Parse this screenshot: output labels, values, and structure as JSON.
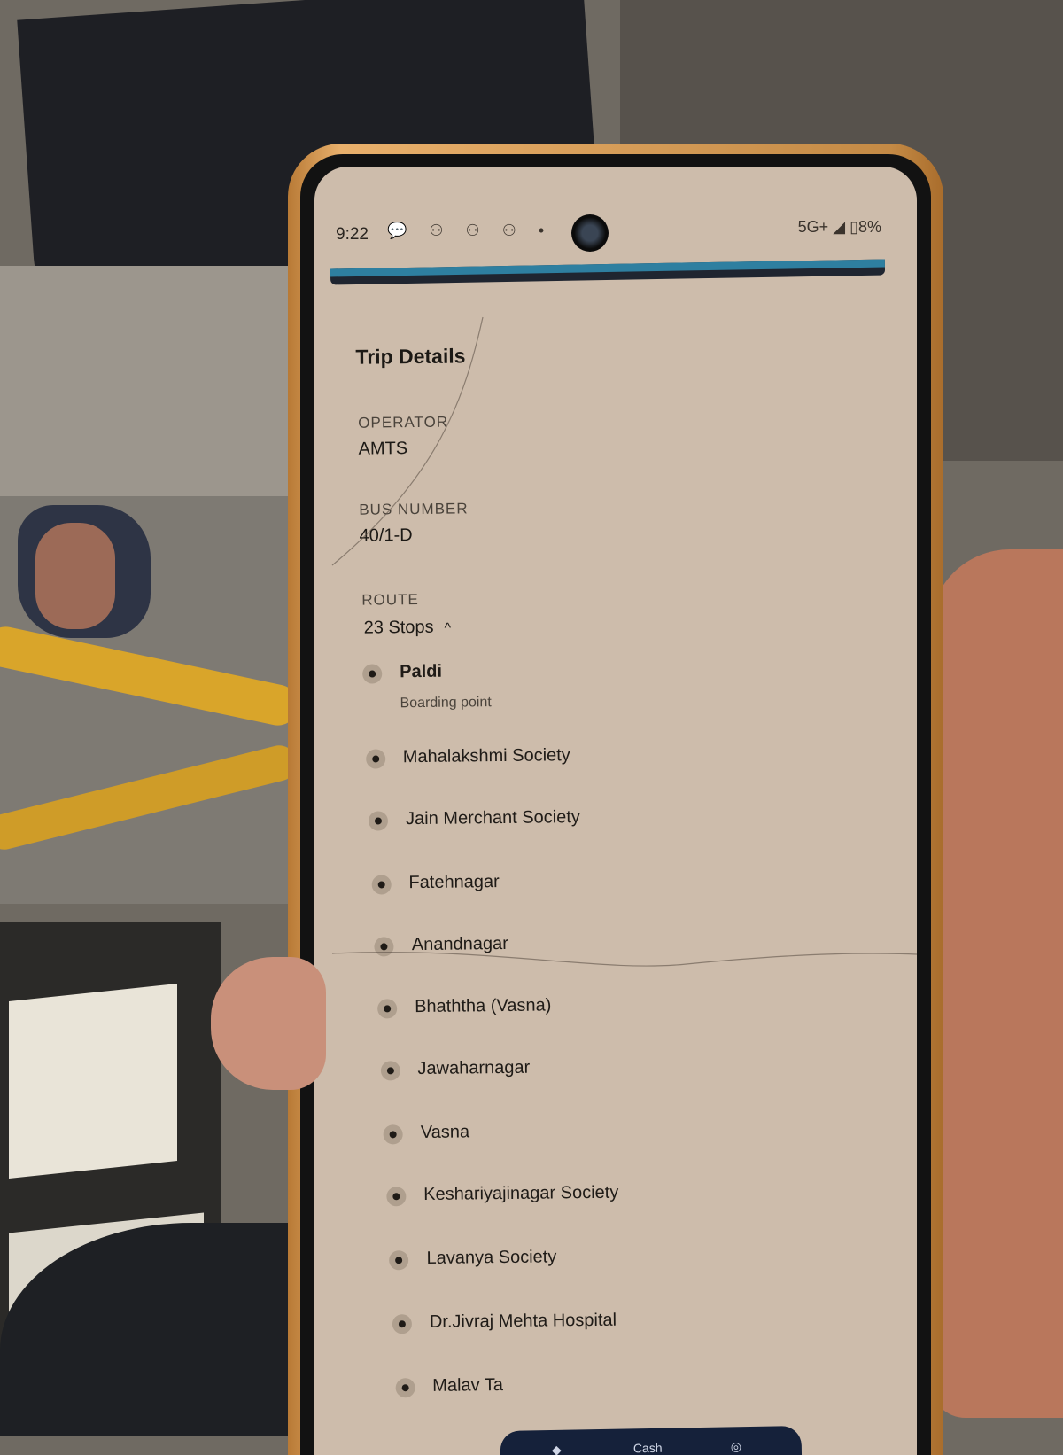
{
  "status_bar": {
    "time": "9:22",
    "notification_icons": "💬 ⚇ ⚇ ⚇ •",
    "signal": "5G+",
    "battery": "8%"
  },
  "trip": {
    "title": "Trip Details",
    "operator_label": "OPERATOR",
    "operator_value": "AMTS",
    "bus_number_label": "BUS NUMBER",
    "bus_number_value": "40/1-D",
    "route_label": "ROUTE",
    "route_stops": "23 Stops",
    "route_expanded": true
  },
  "stops": [
    {
      "name": "Paldi",
      "sub": "Boarding point"
    },
    {
      "name": "Mahalakshmi Society"
    },
    {
      "name": "Jain Merchant Society"
    },
    {
      "name": "Fatehnagar"
    },
    {
      "name": "Anandnagar"
    },
    {
      "name": "Bhaththa (Vasna)"
    },
    {
      "name": "Jawaharnagar"
    },
    {
      "name": "Vasna"
    },
    {
      "name": "Keshariyajinagar Society"
    },
    {
      "name": "Lavanya Society"
    },
    {
      "name": "Dr.Jivraj Mehta Hospital"
    },
    {
      "name": "Malav Ta"
    }
  ],
  "bottom_nav": {
    "center_label": "Cash"
  },
  "colors": {
    "screen_bg": "#cdbcab",
    "progress_accent": "#2e7fa0",
    "frame": "#d9a05a"
  }
}
